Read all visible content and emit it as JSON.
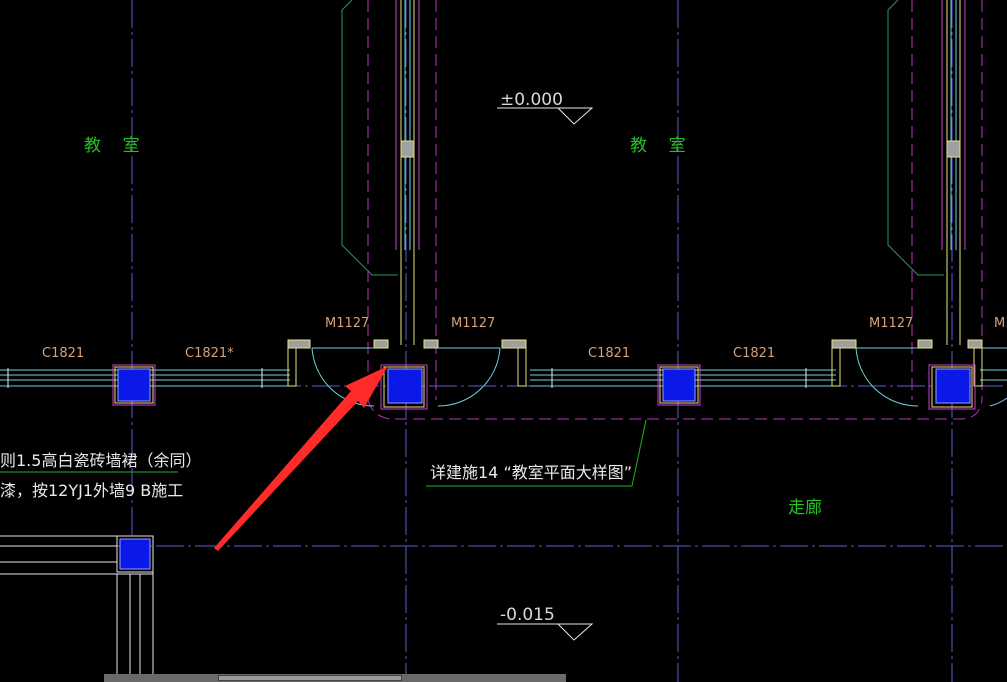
{
  "rooms": {
    "classroom_left": "教    室",
    "classroom_right": "教    室",
    "corridor": "走廊"
  },
  "elevations": {
    "top": "±0.000",
    "bottom": "-0.015"
  },
  "windows": [
    "C1821",
    "C1821*",
    "C1821",
    "C1821"
  ],
  "doors": [
    "M1127",
    "M1127",
    "M1127",
    "M1"
  ],
  "notes": {
    "line1": "则1.5高白瓷砖墙裙（余同）",
    "line2": "漆，按12YJ1外墙9 B施工",
    "reference": "详建施14 “教室平面大样图”"
  },
  "colors": {
    "axis": "#5b5bd6",
    "wall_yellow": "#e6e27a",
    "wall_magenta": "#d43cd4",
    "glazing": "#6fd0e0",
    "column": "#0a18e8",
    "leader": "#1fb41f",
    "arrow": "#ff2a2a"
  }
}
